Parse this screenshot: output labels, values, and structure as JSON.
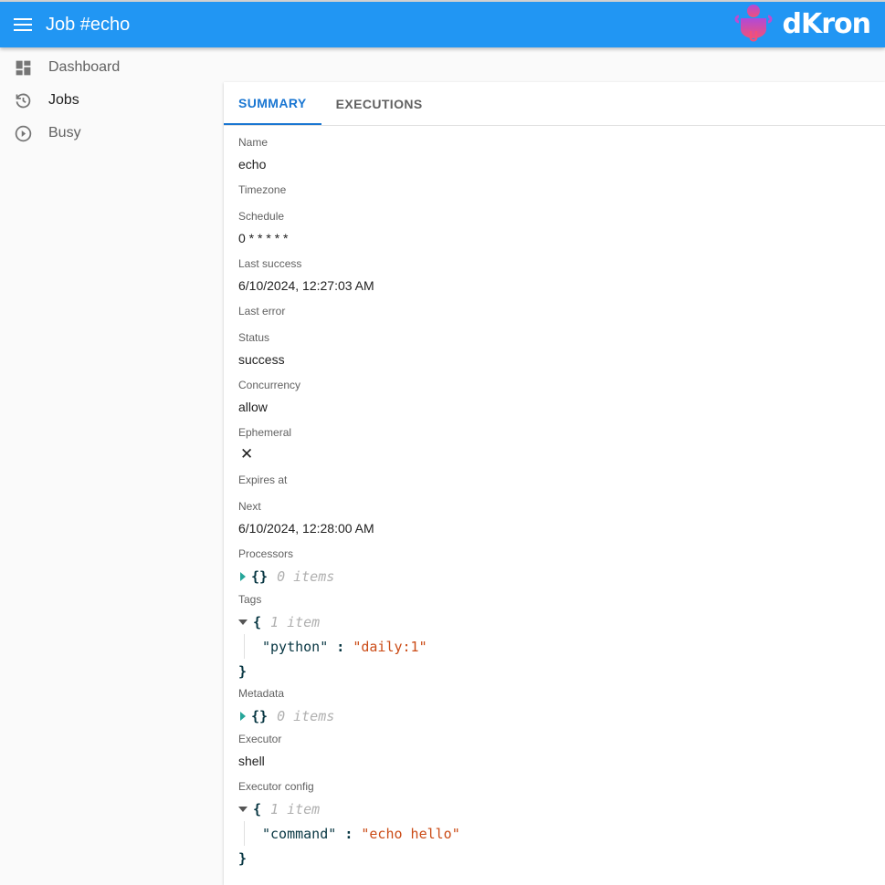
{
  "header": {
    "title": "Job #echo",
    "logo_text": "dKron"
  },
  "sidebar": {
    "items": [
      {
        "label": "Dashboard",
        "icon": "dashboard-icon"
      },
      {
        "label": "Jobs",
        "icon": "history-icon"
      },
      {
        "label": "Busy",
        "icon": "play-circle-icon"
      }
    ]
  },
  "tabs": [
    {
      "label": "SUMMARY",
      "active": true
    },
    {
      "label": "EXECUTIONS",
      "active": false
    }
  ],
  "fields": {
    "name": {
      "label": "Name",
      "value": "echo"
    },
    "timezone": {
      "label": "Timezone"
    },
    "schedule": {
      "label": "Schedule",
      "value": "0 * * * * *"
    },
    "last_success": {
      "label": "Last success",
      "value": "6/10/2024, 12:27:03 AM"
    },
    "last_error": {
      "label": "Last error"
    },
    "status": {
      "label": "Status",
      "value": "success"
    },
    "concurrency": {
      "label": "Concurrency",
      "value": "allow"
    },
    "ephemeral": {
      "label": "Ephemeral",
      "value": "✕"
    },
    "expires_at": {
      "label": "Expires at"
    },
    "next": {
      "label": "Next",
      "value": "6/10/2024, 12:28:00 AM"
    },
    "processors": {
      "label": "Processors",
      "braces": "{}",
      "count": "0 items"
    },
    "tags": {
      "label": "Tags",
      "open": "{",
      "close": "}",
      "count": "1 item",
      "key": "\"python\"",
      "sep": ":",
      "value": "\"daily:1\""
    },
    "metadata": {
      "label": "Metadata",
      "braces": "{}",
      "count": "0 items"
    },
    "executor": {
      "label": "Executor",
      "value": "shell"
    },
    "executor_config": {
      "label": "Executor config",
      "open": "{",
      "close": "}",
      "count": "1 item",
      "key": "\"command\"",
      "sep": ":",
      "value": "\"echo hello\""
    }
  }
}
